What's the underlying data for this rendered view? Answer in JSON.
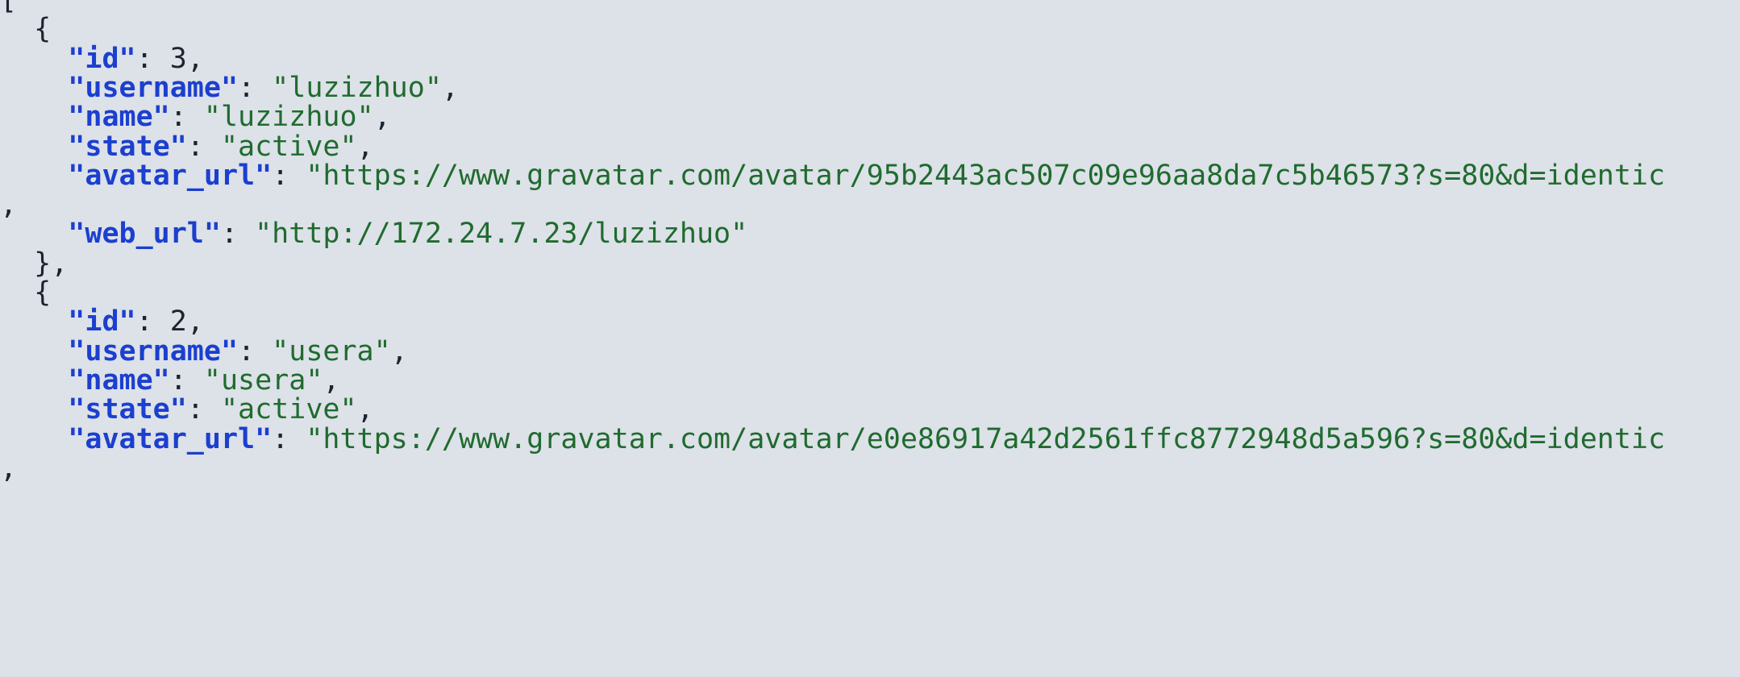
{
  "json_viewer": {
    "lines": [
      {
        "indent": "",
        "segments": [
          {
            "t": "p",
            "v": "["
          }
        ]
      },
      {
        "indent": "  ",
        "segments": [
          {
            "t": "p",
            "v": "{"
          }
        ]
      },
      {
        "indent": "    ",
        "segments": [
          {
            "t": "k",
            "v": "\"id\""
          },
          {
            "t": "p",
            "v": ": "
          },
          {
            "t": "n",
            "v": "3"
          },
          {
            "t": "p",
            "v": ","
          }
        ]
      },
      {
        "indent": "    ",
        "segments": [
          {
            "t": "k",
            "v": "\"username\""
          },
          {
            "t": "p",
            "v": ": "
          },
          {
            "t": "s",
            "v": "\"luzizhuo\""
          },
          {
            "t": "p",
            "v": ","
          }
        ]
      },
      {
        "indent": "    ",
        "segments": [
          {
            "t": "k",
            "v": "\"name\""
          },
          {
            "t": "p",
            "v": ": "
          },
          {
            "t": "s",
            "v": "\"luzizhuo\""
          },
          {
            "t": "p",
            "v": ","
          }
        ]
      },
      {
        "indent": "    ",
        "segments": [
          {
            "t": "k",
            "v": "\"state\""
          },
          {
            "t": "p",
            "v": ": "
          },
          {
            "t": "s",
            "v": "\"active\""
          },
          {
            "t": "p",
            "v": ","
          }
        ]
      },
      {
        "indent": "    ",
        "segments": [
          {
            "t": "k",
            "v": "\"avatar_url\""
          },
          {
            "t": "p",
            "v": ": "
          },
          {
            "t": "s",
            "v": "\"https://www.gravatar.com/avatar/95b2443ac507c09e96aa8da7c5b46573?s=80&d=identic"
          }
        ]
      },
      {
        "indent": "",
        "segments": [
          {
            "t": "p",
            "v": ","
          }
        ]
      },
      {
        "indent": "    ",
        "segments": [
          {
            "t": "k",
            "v": "\"web_url\""
          },
          {
            "t": "p",
            "v": ": "
          },
          {
            "t": "s",
            "v": "\"http://172.24.7.23/luzizhuo\""
          }
        ]
      },
      {
        "indent": "  ",
        "segments": [
          {
            "t": "p",
            "v": "},"
          }
        ]
      },
      {
        "indent": "  ",
        "segments": [
          {
            "t": "p",
            "v": "{"
          }
        ]
      },
      {
        "indent": "    ",
        "segments": [
          {
            "t": "k",
            "v": "\"id\""
          },
          {
            "t": "p",
            "v": ": "
          },
          {
            "t": "n",
            "v": "2"
          },
          {
            "t": "p",
            "v": ","
          }
        ]
      },
      {
        "indent": "    ",
        "segments": [
          {
            "t": "k",
            "v": "\"username\""
          },
          {
            "t": "p",
            "v": ": "
          },
          {
            "t": "s",
            "v": "\"usera\""
          },
          {
            "t": "p",
            "v": ","
          }
        ]
      },
      {
        "indent": "    ",
        "segments": [
          {
            "t": "k",
            "v": "\"name\""
          },
          {
            "t": "p",
            "v": ": "
          },
          {
            "t": "s",
            "v": "\"usera\""
          },
          {
            "t": "p",
            "v": ","
          }
        ]
      },
      {
        "indent": "    ",
        "segments": [
          {
            "t": "k",
            "v": "\"state\""
          },
          {
            "t": "p",
            "v": ": "
          },
          {
            "t": "s",
            "v": "\"active\""
          },
          {
            "t": "p",
            "v": ","
          }
        ]
      },
      {
        "indent": "    ",
        "segments": [
          {
            "t": "k",
            "v": "\"avatar_url\""
          },
          {
            "t": "p",
            "v": ": "
          },
          {
            "t": "s",
            "v": "\"https://www.gravatar.com/avatar/e0e86917a42d2561ffc8772948d5a596?s=80&d=identic"
          }
        ]
      },
      {
        "indent": "",
        "segments": [
          {
            "t": "p",
            "v": ","
          }
        ]
      }
    ]
  },
  "colors": {
    "background": "#dde1e8",
    "key": "#1b3fcf",
    "string": "#1f6b2e",
    "text": "#1f2330"
  }
}
